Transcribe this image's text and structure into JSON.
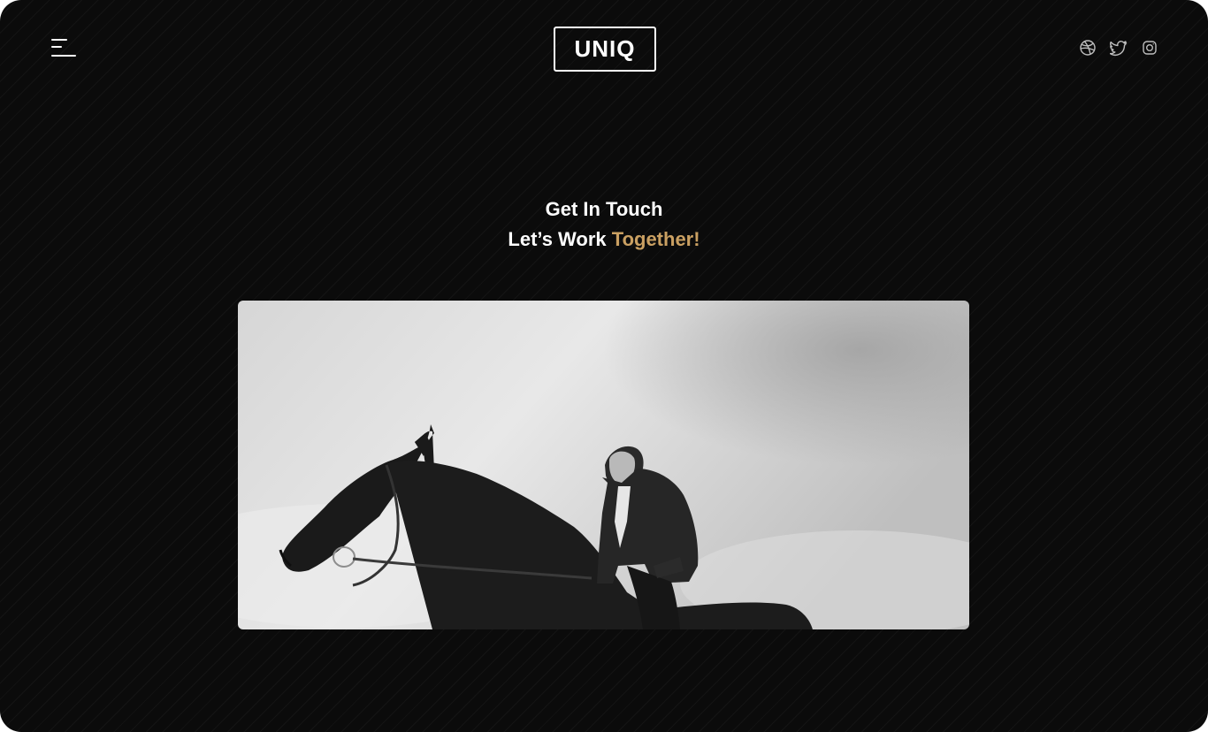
{
  "header": {
    "logo_text": "UNIQ",
    "menu_icon": "hamburger-menu-icon",
    "social_icons": [
      "dribbble-icon",
      "twitter-icon",
      "instagram-icon"
    ]
  },
  "hero": {
    "line1": "Get In Touch",
    "line2_prefix": "Let’s Work ",
    "line2_accent": "Together!"
  },
  "colors": {
    "background": "#0b0b0b",
    "text": "#ffffff",
    "accent": "#caa062"
  }
}
